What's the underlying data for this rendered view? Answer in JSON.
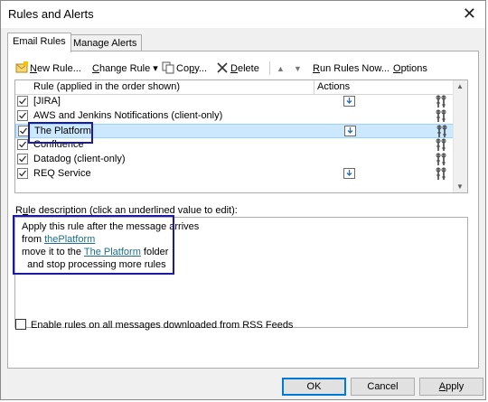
{
  "window": {
    "title": "Rules and Alerts",
    "close_glyph": "✕"
  },
  "tabs": [
    {
      "label": "Email Rules",
      "active": true
    },
    {
      "label": "Manage Alerts",
      "active": false
    }
  ],
  "toolbar": {
    "new_rule": {
      "mnemonic": "N",
      "rest": "ew Rule..."
    },
    "change_rule": {
      "mnemonic": "C",
      "rest": "hange Rule"
    },
    "copy": {
      "pre": "Co",
      "mnemonic": "p",
      "post": "y..."
    },
    "delete": {
      "mnemonic": "D",
      "rest": "elete"
    },
    "run_rules": {
      "mnemonic": "R",
      "rest": "un Rules Now..."
    },
    "options": {
      "mnemonic": "O",
      "rest": "ptions"
    },
    "dropdown_glyph": "▾",
    "move_up_glyph": "▲",
    "move_down_glyph": "▼"
  },
  "rules_table": {
    "col_rule": "Rule (applied in the order shown)",
    "col_actions": "Actions",
    "rows": [
      {
        "name": "[JIRA]",
        "checked": true,
        "selected": false,
        "has_action_icon": true
      },
      {
        "name": "AWS and Jenkins Notifications  (client-only)",
        "checked": true,
        "selected": false,
        "has_action_icon": false
      },
      {
        "name": "The Platform",
        "checked": true,
        "selected": true,
        "has_action_icon": true
      },
      {
        "name": "Confluence",
        "checked": true,
        "selected": false,
        "has_action_icon": false
      },
      {
        "name": "Datadog  (client-only)",
        "checked": true,
        "selected": false,
        "has_action_icon": false
      },
      {
        "name": "REQ Service",
        "checked": true,
        "selected": false,
        "has_action_icon": true
      }
    ]
  },
  "description": {
    "label_mnemonic": "u",
    "label_pre": "R",
    "label_post": "le description (click an underlined value to edit):",
    "line1": "Apply this rule after the message arrives",
    "line2_pre": "from ",
    "line2_link": "thePlatform",
    "line3_pre": "move it to the ",
    "line3_link": "The Platform",
    "line3_post": " folder",
    "line4": "  and stop processing more rules"
  },
  "rss_option": {
    "label": "Enable rules on all messages downloaded from RSS Feeds",
    "checked": false
  },
  "buttons": {
    "ok": "OK",
    "cancel": "Cancel",
    "apply_mnemonic": "A",
    "apply_rest": "pply"
  },
  "colors": {
    "highlight_box": "#1a1aa6",
    "selection": "#cce8ff",
    "link": "#1c6f8e"
  }
}
